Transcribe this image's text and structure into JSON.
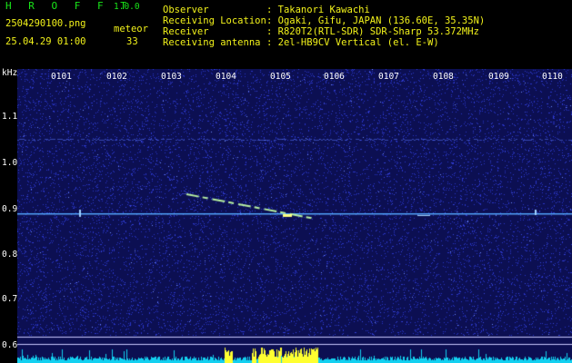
{
  "header": {
    "app_title": "H R O F F T",
    "app_version": "1.0.0",
    "file_name": "2504290100.png",
    "datetime": "25.04.29 01:00",
    "counter_label": "meteor",
    "counter_value": "33",
    "info_labels": [
      "Observer",
      "Receiving Location",
      "Receiver",
      "Receiving antenna"
    ],
    "info_values": [
      ": Takanori Kawachi",
      ": Ogaki, Gifu, JAPAN (136.60E, 35.35N)",
      ": R820T2(RTL-SDR) SDR-Sharp 53.372MHz",
      ": 2el-HB9CV Vertical (el. E-W)"
    ]
  },
  "spectrogram": {
    "y_unit": "kHz",
    "y_ticks": [
      "1.1",
      "1.0",
      "0.9",
      "0.8",
      "0.7",
      "0.6"
    ],
    "x_ticks": [
      "0101",
      "0102",
      "0103",
      "0104",
      "0105",
      "0106",
      "0107",
      "0108",
      "0109",
      "0110"
    ],
    "colors": {
      "background": "#0c0f52",
      "noise": "#2a36c8",
      "carrier": "#4fa8ff",
      "trail": "#b7f0a0",
      "level_bars": "#13d0f0",
      "level_peaks": "#ffff30",
      "ref_lines": "#c8c8ff"
    }
  }
}
